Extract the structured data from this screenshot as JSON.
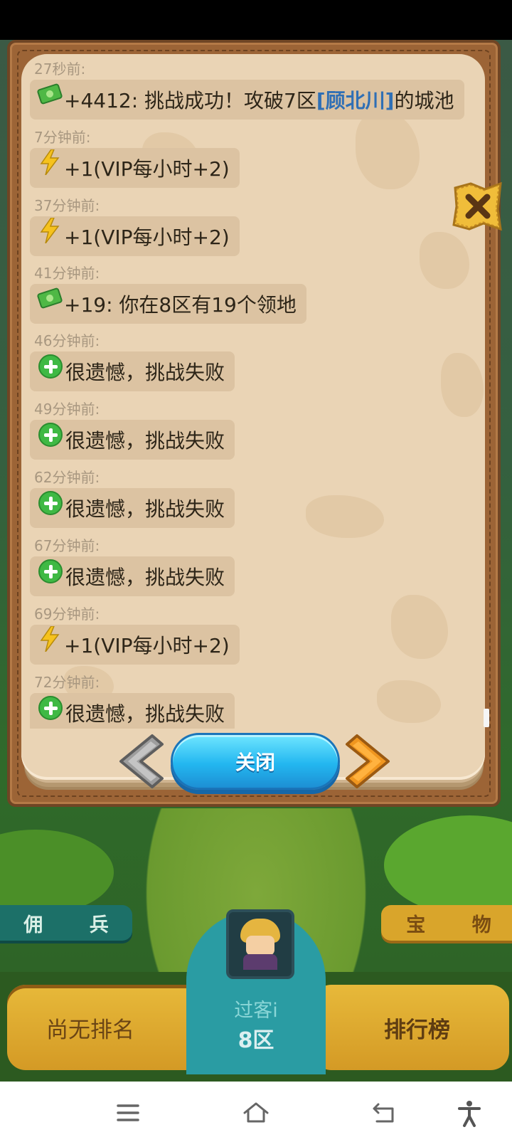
{
  "log": {
    "entries": [
      {
        "time": "27秒前:",
        "icon": "money-icon",
        "text": "+4412: 挑战成功！攻破7区",
        "highlight": "[顾北川]",
        "suffix": "的城池"
      },
      {
        "time": "7分钟前:",
        "icon": "lightning-icon",
        "text": "+1(VIP每小时+2)"
      },
      {
        "time": "37分钟前:",
        "icon": "lightning-icon",
        "text": "+1(VIP每小时+2)"
      },
      {
        "time": "41分钟前:",
        "icon": "money-icon",
        "text": "+19: 你在8区有19个领地"
      },
      {
        "time": "46分钟前:",
        "icon": "plus-icon",
        "text": "很遗憾，挑战失败"
      },
      {
        "time": "49分钟前:",
        "icon": "plus-icon",
        "text": "很遗憾，挑战失败"
      },
      {
        "time": "62分钟前:",
        "icon": "plus-icon",
        "text": "很遗憾，挑战失败"
      },
      {
        "time": "67分钟前:",
        "icon": "plus-icon",
        "text": "很遗憾，挑战失败"
      },
      {
        "time": "69分钟前:",
        "icon": "lightning-icon",
        "text": "+1(VIP每小时+2)"
      },
      {
        "time": "72分钟前:",
        "icon": "plus-icon",
        "text": "很遗憾，挑战失败"
      }
    ]
  },
  "popup": {
    "close_label": "关闭"
  },
  "side": {
    "mercenary_label": "佣 兵",
    "treasure_label": "宝 物"
  },
  "bottom": {
    "rank_label": "尚无排名",
    "player_name": "过客i",
    "zone": "8区",
    "leaderboard_label": "排行榜"
  },
  "colors": {
    "highlight": "#2f6fb5",
    "close_button": "#23b7f0",
    "frame": "#9c6436"
  }
}
